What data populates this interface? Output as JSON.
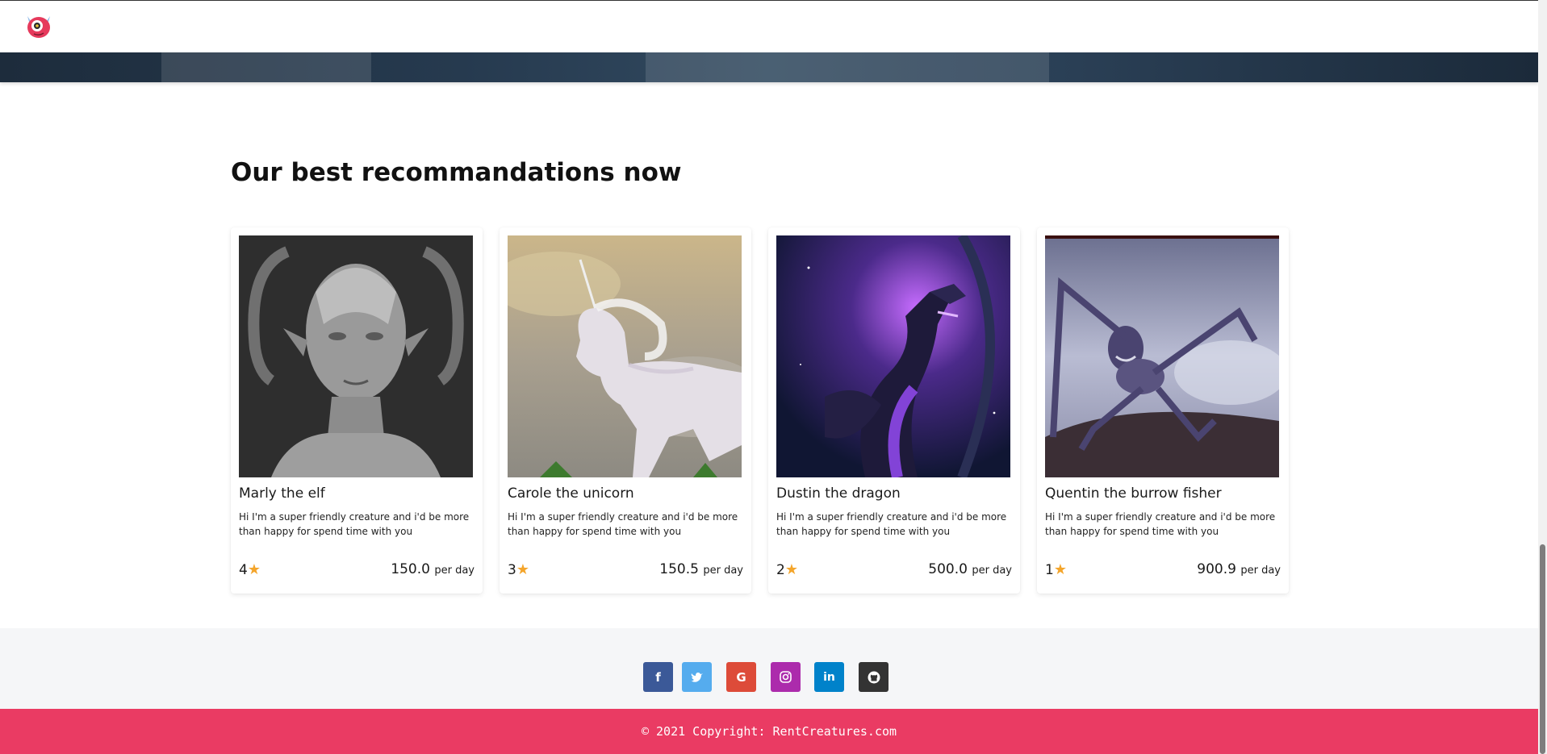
{
  "header": {
    "logo": "monster-logo-icon"
  },
  "main": {
    "title": "Our best recommandations now",
    "cards": [
      {
        "name": "Marly the elf",
        "description": "Hi I'm a super friendly creature and i'd be more than happy for spend time with you",
        "rating": "4",
        "price": "150.0",
        "per": "per day"
      },
      {
        "name": "Carole the unicorn",
        "description": "Hi I'm a super friendly creature and i'd be more than happy for spend time with you",
        "rating": "3",
        "price": "150.5",
        "per": "per day"
      },
      {
        "name": "Dustin the dragon",
        "description": "Hi I'm a super friendly creature and i'd be more than happy for spend time with you",
        "rating": "2",
        "price": "500.0",
        "per": "per day"
      },
      {
        "name": "Quentin the burrow fisher",
        "description": "Hi I'm a super friendly creature and i'd be more than happy for spend time with you",
        "rating": "1",
        "price": "900.9",
        "per": "per day"
      }
    ]
  },
  "footer": {
    "social": [
      {
        "icon": "facebook-icon",
        "glyph": "f",
        "color": "#3b5998"
      },
      {
        "icon": "twitter-icon",
        "glyph": "t",
        "color": "#55acee"
      },
      {
        "icon": "google-icon",
        "glyph": "G",
        "color": "#dd4b39"
      },
      {
        "icon": "instagram-icon",
        "glyph": "◎",
        "color": "#ac2bac"
      },
      {
        "icon": "linkedin-icon",
        "glyph": "in",
        "color": "#0082ca"
      },
      {
        "icon": "github-icon",
        "glyph": "●",
        "color": "#333333"
      }
    ],
    "copyright": "© 2021 Copyright: RentCreatures.com"
  },
  "colors": {
    "accent": "#ea3b63",
    "star": "#f4a52b"
  }
}
